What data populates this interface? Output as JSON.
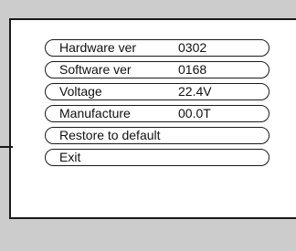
{
  "menu": {
    "items": [
      {
        "label": "Hardware ver",
        "value": "0302"
      },
      {
        "label": "Software ver",
        "value": "0168"
      },
      {
        "label": "Voltage",
        "value": "22.4V"
      },
      {
        "label": "Manufacture",
        "value": "00.0T"
      },
      {
        "label": "Restore to default",
        "value": ""
      },
      {
        "label": "Exit",
        "value": ""
      }
    ]
  },
  "colors": {
    "background": "#cccccc",
    "panel": "#ffffff",
    "border": "#1a1a1a"
  }
}
